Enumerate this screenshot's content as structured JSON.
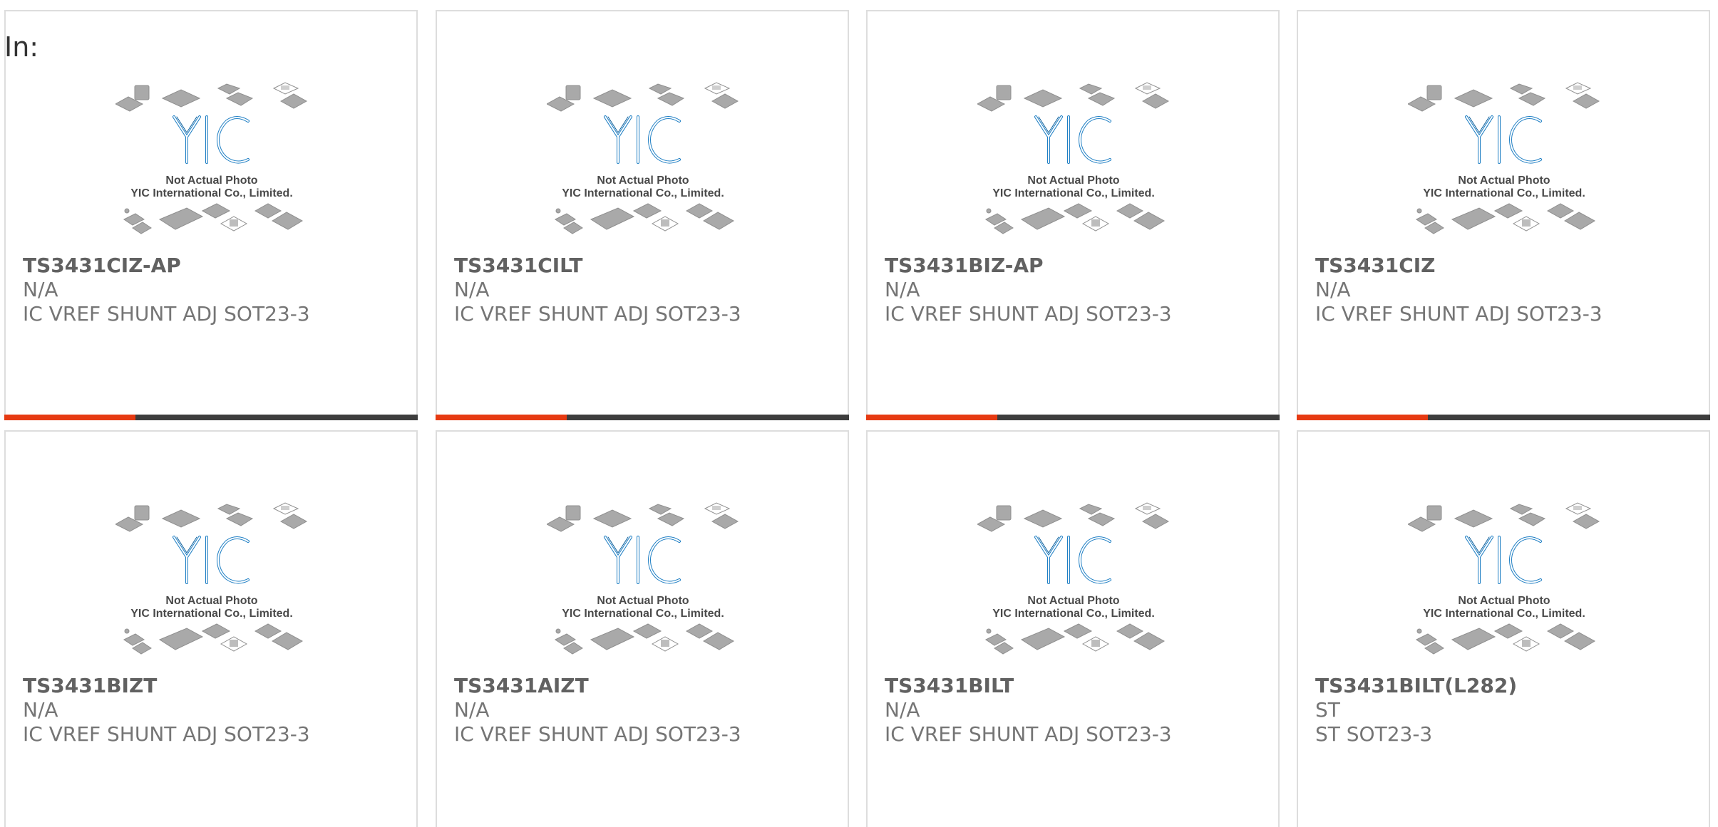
{
  "header": {
    "in_label": "In:"
  },
  "image_placeholder": {
    "logo_text": "YIC",
    "caption_line1": "Not Actual Photo",
    "caption_line2": "YIC International Co., Limited."
  },
  "colors": {
    "accent": "#e63a12",
    "bar": "#3d3d3d",
    "logo_blue": "#1f7fc4",
    "border": "#dddddd"
  },
  "products": [
    {
      "part_number": "TS3431CIZ-AP",
      "manufacturer": "N/A",
      "description": "IC VREF SHUNT ADJ SOT23-3"
    },
    {
      "part_number": "TS3431CILT",
      "manufacturer": "N/A",
      "description": "IC VREF SHUNT ADJ SOT23-3"
    },
    {
      "part_number": "TS3431BIZ-AP",
      "manufacturer": "N/A",
      "description": "IC VREF SHUNT ADJ SOT23-3"
    },
    {
      "part_number": "TS3431CIZ",
      "manufacturer": "N/A",
      "description": "IC VREF SHUNT ADJ SOT23-3"
    },
    {
      "part_number": "TS3431BIZT",
      "manufacturer": "N/A",
      "description": "IC VREF SHUNT ADJ SOT23-3"
    },
    {
      "part_number": "TS3431AIZT",
      "manufacturer": "N/A",
      "description": "IC VREF SHUNT ADJ SOT23-3"
    },
    {
      "part_number": "TS3431BILT",
      "manufacturer": "N/A",
      "description": "IC VREF SHUNT ADJ SOT23-3"
    },
    {
      "part_number": "TS3431BILT(L282)",
      "manufacturer": "ST",
      "description": "ST SOT23-3"
    }
  ]
}
